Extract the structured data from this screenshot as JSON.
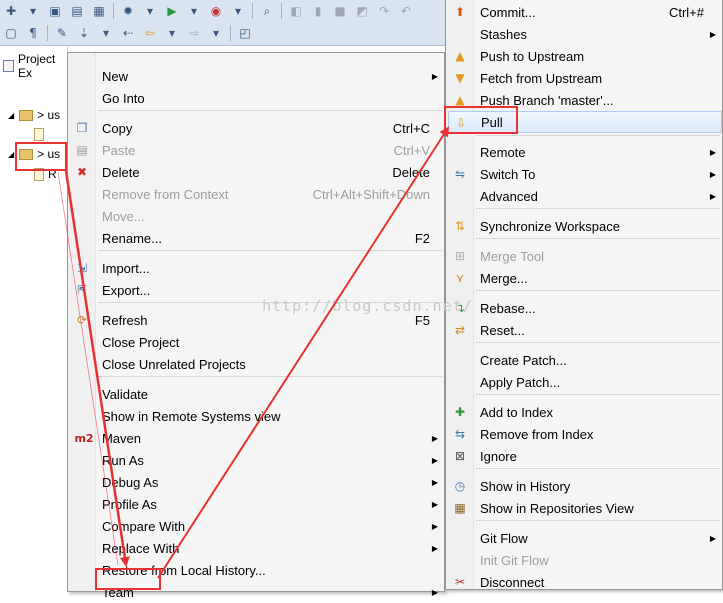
{
  "explorer": {
    "tab_label": "Project Ex",
    "node1_label": "> us",
    "node2_label": "> us",
    "node3_label": "R"
  },
  "context_menu": {
    "items": [
      {
        "label": "New",
        "shortcut": "",
        "submenu": true,
        "disabled": false,
        "icon": ""
      },
      {
        "label": "Go Into",
        "shortcut": "",
        "submenu": false,
        "disabled": false,
        "icon": ""
      },
      {
        "label": "Copy",
        "shortcut": "Ctrl+C",
        "submenu": false,
        "disabled": false,
        "icon": "copy-icon"
      },
      {
        "label": "Paste",
        "shortcut": "Ctrl+V",
        "submenu": false,
        "disabled": true,
        "icon": "paste-icon"
      },
      {
        "label": "Delete",
        "shortcut": "Delete",
        "submenu": false,
        "disabled": false,
        "icon": "delete-icon"
      },
      {
        "label": "Remove from Context",
        "shortcut": "Ctrl+Alt+Shift+Down",
        "submenu": false,
        "disabled": true,
        "icon": ""
      },
      {
        "label": "Move...",
        "shortcut": "",
        "submenu": false,
        "disabled": true,
        "icon": ""
      },
      {
        "label": "Rename...",
        "shortcut": "F2",
        "submenu": false,
        "disabled": false,
        "icon": ""
      },
      {
        "label": "Import...",
        "shortcut": "",
        "submenu": false,
        "disabled": false,
        "icon": "import-icon"
      },
      {
        "label": "Export...",
        "shortcut": "",
        "submenu": false,
        "disabled": false,
        "icon": "export-icon"
      },
      {
        "label": "Refresh",
        "shortcut": "F5",
        "submenu": false,
        "disabled": false,
        "icon": "refresh-icon"
      },
      {
        "label": "Close Project",
        "shortcut": "",
        "submenu": false,
        "disabled": false,
        "icon": ""
      },
      {
        "label": "Close Unrelated Projects",
        "shortcut": "",
        "submenu": false,
        "disabled": false,
        "icon": ""
      },
      {
        "label": "Validate",
        "shortcut": "",
        "submenu": false,
        "disabled": false,
        "icon": ""
      },
      {
        "label": "Show in Remote Systems view",
        "shortcut": "",
        "submenu": false,
        "disabled": false,
        "icon": ""
      },
      {
        "label": "Maven",
        "shortcut": "",
        "submenu": true,
        "disabled": false,
        "icon": "maven-icon"
      },
      {
        "label": "Run As",
        "shortcut": "",
        "submenu": true,
        "disabled": false,
        "icon": ""
      },
      {
        "label": "Debug As",
        "shortcut": "",
        "submenu": true,
        "disabled": false,
        "icon": ""
      },
      {
        "label": "Profile As",
        "shortcut": "",
        "submenu": true,
        "disabled": false,
        "icon": ""
      },
      {
        "label": "Compare With",
        "shortcut": "",
        "submenu": true,
        "disabled": false,
        "icon": ""
      },
      {
        "label": "Replace With",
        "shortcut": "",
        "submenu": true,
        "disabled": false,
        "icon": ""
      },
      {
        "label": "Restore from Local History...",
        "shortcut": "",
        "submenu": false,
        "disabled": false,
        "icon": ""
      },
      {
        "label": "Team",
        "shortcut": "",
        "submenu": true,
        "disabled": false,
        "icon": ""
      }
    ],
    "maven_badge": "m2"
  },
  "team_menu": {
    "items": [
      {
        "label": "Commit...",
        "shortcut": "Ctrl+#",
        "submenu": false,
        "disabled": false,
        "icon": "commit-icon"
      },
      {
        "label": "Stashes",
        "shortcut": "",
        "submenu": true,
        "disabled": false,
        "icon": ""
      },
      {
        "label": "Push to Upstream",
        "shortcut": "",
        "submenu": false,
        "disabled": false,
        "icon": "push-icon"
      },
      {
        "label": "Fetch from Upstream",
        "shortcut": "",
        "submenu": false,
        "disabled": false,
        "icon": "fetch-icon"
      },
      {
        "label": "Push Branch 'master'...",
        "shortcut": "",
        "submenu": false,
        "disabled": false,
        "icon": "push-branch-icon"
      },
      {
        "label": "Pull",
        "shortcut": "",
        "submenu": false,
        "disabled": false,
        "icon": "pull-icon"
      },
      {
        "label": "Remote",
        "shortcut": "",
        "submenu": true,
        "disabled": false,
        "icon": ""
      },
      {
        "label": "Switch To",
        "shortcut": "",
        "submenu": true,
        "disabled": false,
        "icon": "switch-icon"
      },
      {
        "label": "Advanced",
        "shortcut": "",
        "submenu": true,
        "disabled": false,
        "icon": ""
      },
      {
        "label": "Synchronize Workspace",
        "shortcut": "",
        "submenu": false,
        "disabled": false,
        "icon": "sync-icon"
      },
      {
        "label": "Merge Tool",
        "shortcut": "",
        "submenu": false,
        "disabled": true,
        "icon": "merge-tool-icon"
      },
      {
        "label": "Merge...",
        "shortcut": "",
        "submenu": false,
        "disabled": false,
        "icon": "merge-icon"
      },
      {
        "label": "Rebase...",
        "shortcut": "",
        "submenu": false,
        "disabled": false,
        "icon": "rebase-icon"
      },
      {
        "label": "Reset...",
        "shortcut": "",
        "submenu": false,
        "disabled": false,
        "icon": "reset-icon"
      },
      {
        "label": "Create Patch...",
        "shortcut": "",
        "submenu": false,
        "disabled": false,
        "icon": ""
      },
      {
        "label": "Apply Patch...",
        "shortcut": "",
        "submenu": false,
        "disabled": false,
        "icon": ""
      },
      {
        "label": "Add to Index",
        "shortcut": "",
        "submenu": false,
        "disabled": false,
        "icon": "add-index-icon"
      },
      {
        "label": "Remove from Index",
        "shortcut": "",
        "submenu": false,
        "disabled": false,
        "icon": "remove-index-icon"
      },
      {
        "label": "Ignore",
        "shortcut": "",
        "submenu": false,
        "disabled": false,
        "icon": "ignore-icon"
      },
      {
        "label": "Show in History",
        "shortcut": "",
        "submenu": false,
        "disabled": false,
        "icon": "history-icon"
      },
      {
        "label": "Show in Repositories View",
        "shortcut": "",
        "submenu": false,
        "disabled": false,
        "icon": "repositories-icon"
      },
      {
        "label": "Git Flow",
        "shortcut": "",
        "submenu": true,
        "disabled": false,
        "icon": ""
      },
      {
        "label": "Init Git Flow",
        "shortcut": "",
        "submenu": false,
        "disabled": true,
        "icon": ""
      },
      {
        "label": "Disconnect",
        "shortcut": "",
        "submenu": false,
        "disabled": false,
        "icon": "disconnect-icon"
      }
    ]
  },
  "watermark": "http://blog.csdn.net/",
  "colors": {
    "annotation_red": "#e83232",
    "highlight": "#dbe9fb",
    "toolbar": "#d9e4f1"
  }
}
